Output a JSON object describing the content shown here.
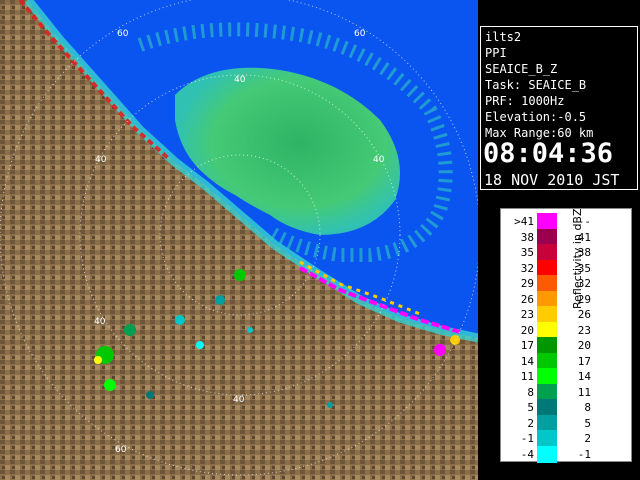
{
  "info": {
    "site": "ilts2",
    "scan_type": "PPI",
    "product": "SEAICE_B_Z",
    "task": "Task: SEAICE_B",
    "prf": "PRF: 1000Hz",
    "elevation": "Elevation:-0.5",
    "max_range": "Max Range:60 km",
    "time": "08:04:36",
    "date": "18 NOV 2010 JST"
  },
  "range_rings": {
    "labels": [
      "40",
      "40",
      "40",
      "60",
      "60",
      "40",
      "40",
      "60"
    ]
  },
  "legend": {
    "title": "Reflectivity in dBZ",
    "rows": [
      {
        "lo": ">41",
        "hi": "---",
        "color": "#ff00ff"
      },
      {
        "lo": "38",
        "hi": "41",
        "color": "#9b004f"
      },
      {
        "lo": "35",
        "hi": "38",
        "color": "#c8003c"
      },
      {
        "lo": "32",
        "hi": "35",
        "color": "#ff0000"
      },
      {
        "lo": "29",
        "hi": "32",
        "color": "#ff5a00"
      },
      {
        "lo": "26",
        "hi": "29",
        "color": "#ff9900"
      },
      {
        "lo": "23",
        "hi": "26",
        "color": "#ffcc00"
      },
      {
        "lo": "20",
        "hi": "23",
        "color": "#ffff00"
      },
      {
        "lo": "17",
        "hi": "20",
        "color": "#009600"
      },
      {
        "lo": "14",
        "hi": "17",
        "color": "#00c800"
      },
      {
        "lo": "11",
        "hi": "14",
        "color": "#00ff00"
      },
      {
        "lo": "8",
        "hi": "11",
        "color": "#00a050"
      },
      {
        "lo": "5",
        "hi": "8",
        "color": "#007878"
      },
      {
        "lo": "2",
        "hi": "5",
        "color": "#00a0a0"
      },
      {
        "lo": "-1",
        "hi": "2",
        "color": "#00c8c8"
      },
      {
        "lo": "-4",
        "hi": "-1",
        "color": "#00ffff"
      }
    ]
  },
  "colors": {
    "sea": "#0a55f0",
    "land": "#8b6f4a",
    "land_dark": "#5a4530",
    "echo_green": "#3ec86a",
    "coast_cyan": "#36d2d2"
  }
}
